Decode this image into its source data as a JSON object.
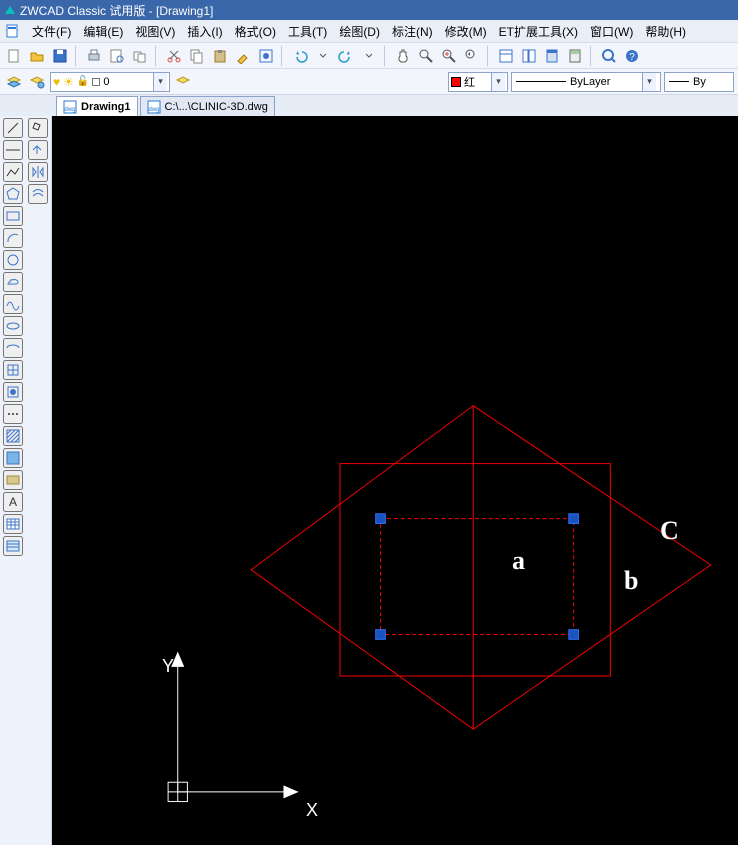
{
  "title": "ZWCAD Classic 试用版 - [Drawing1]",
  "menu": {
    "items": [
      "文件(F)",
      "编辑(E)",
      "视图(V)",
      "插入(I)",
      "格式(O)",
      "工具(T)",
      "绘图(D)",
      "标注(N)",
      "修改(M)",
      "ET扩展工具(X)",
      "窗口(W)",
      "帮助(H)"
    ]
  },
  "layer": {
    "name": "0"
  },
  "color": {
    "name": "红"
  },
  "linetype": {
    "name": "ByLayer"
  },
  "lineweight": {
    "name": "By"
  },
  "tabs": {
    "items": [
      {
        "label": "Drawing1",
        "active": true
      },
      {
        "label": "C:\\...\\CLINIC-3D.dwg",
        "active": false
      }
    ]
  },
  "canvas": {
    "labels": {
      "a": "a",
      "b": "b",
      "c": "C"
    },
    "axis_x": "X",
    "axis_y": "Y"
  }
}
